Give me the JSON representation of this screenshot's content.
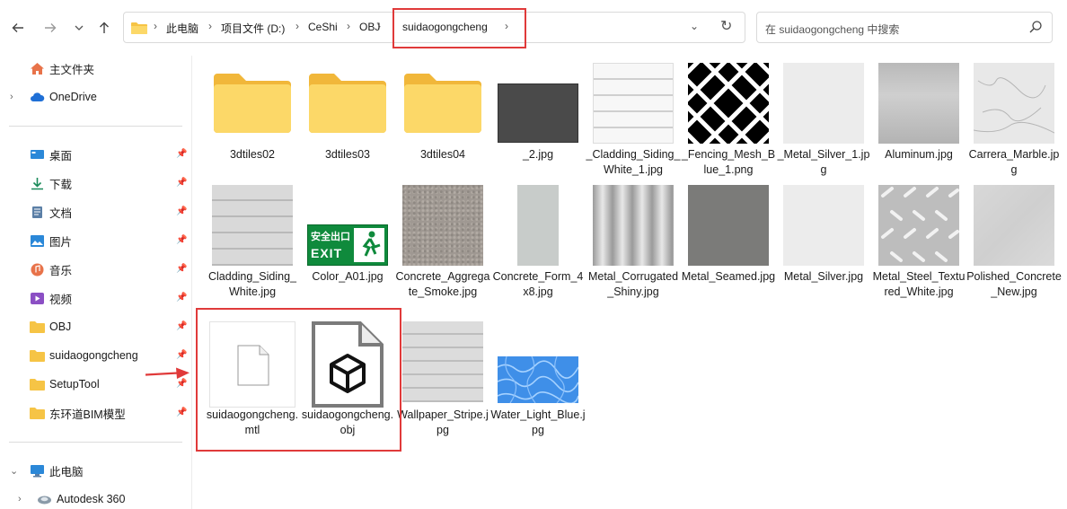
{
  "navigation": {
    "back_icon": "arrow-left-icon",
    "forward_icon": "arrow-right-icon",
    "recent_icon": "chevron-down-icon",
    "up_icon": "arrow-up-icon"
  },
  "address": {
    "crumbs": [
      "此电脑",
      "项目文件 (D:)",
      "CeShi",
      "OBJ",
      "suidaogongcheng"
    ],
    "separator": "›",
    "dropdown_icon": "⌄",
    "refresh_icon": "↻"
  },
  "search": {
    "placeholder": "在 suidaogongcheng 中搜索"
  },
  "sidebar": {
    "items": [
      {
        "label": "主文件夹",
        "icon": "home-icon"
      },
      {
        "label": "OneDrive",
        "icon": "cloud-icon"
      },
      {
        "label": "桌面",
        "icon": "desktop-icon"
      },
      {
        "label": "下载",
        "icon": "download-icon"
      },
      {
        "label": "文档",
        "icon": "document-icon"
      },
      {
        "label": "图片",
        "icon": "pictures-icon"
      },
      {
        "label": "音乐",
        "icon": "music-icon"
      },
      {
        "label": "视频",
        "icon": "video-icon"
      },
      {
        "label": "OBJ",
        "icon": "folder-icon"
      },
      {
        "label": "suidaogongcheng",
        "icon": "folder-icon"
      },
      {
        "label": "SetupTool",
        "icon": "folder-icon"
      },
      {
        "label": "东环道BIM模型",
        "icon": "folder-icon"
      },
      {
        "label": "此电脑",
        "icon": "computer-icon"
      },
      {
        "label": "Autodesk 360",
        "icon": "autodesk-icon"
      }
    ]
  },
  "files": [
    {
      "name": "3dtiles02",
      "kind": "folder"
    },
    {
      "name": "3dtiles03",
      "kind": "folder"
    },
    {
      "name": "3dtiles04",
      "kind": "folder"
    },
    {
      "name": "_2.jpg",
      "kind": "image"
    },
    {
      "name": "_Cladding_Siding_White_1.jpg",
      "kind": "image"
    },
    {
      "name": "_Fencing_Mesh_Blue_1.png",
      "kind": "image"
    },
    {
      "name": "_Metal_Silver_1.jpg",
      "kind": "image"
    },
    {
      "name": "Aluminum.jpg",
      "kind": "image"
    },
    {
      "name": "Carrera_Marble.jpg",
      "kind": "image"
    },
    {
      "name": "Cladding_Siding_White.jpg",
      "kind": "image"
    },
    {
      "name": "Color_A01.jpg",
      "kind": "image"
    },
    {
      "name": "Concrete_Aggregate_Smoke.jpg",
      "kind": "image"
    },
    {
      "name": "Concrete_Form_4x8.jpg",
      "kind": "image"
    },
    {
      "name": "Metal_Corrugated_Shiny.jpg",
      "kind": "image"
    },
    {
      "name": "Metal_Seamed.jpg",
      "kind": "image"
    },
    {
      "name": "Metal_Silver.jpg",
      "kind": "image"
    },
    {
      "name": "Metal_Steel_Textured_White.jpg",
      "kind": "image"
    },
    {
      "name": "Polished_Concrete_New.jpg",
      "kind": "image"
    },
    {
      "name": "suidaogongcheng.mtl",
      "kind": "file"
    },
    {
      "name": "suidaogongcheng.obj",
      "kind": "obj"
    },
    {
      "name": "Wallpaper_Stripe.jpg",
      "kind": "image"
    },
    {
      "name": "Water_Light_Blue.jpg",
      "kind": "image"
    }
  ],
  "exit_sign": {
    "cn": "安全出口",
    "en": "EXIT"
  },
  "colors": {
    "highlight": "#e03a3a",
    "folder": "#f6c445",
    "selection_arrow": "#e03a3a"
  }
}
